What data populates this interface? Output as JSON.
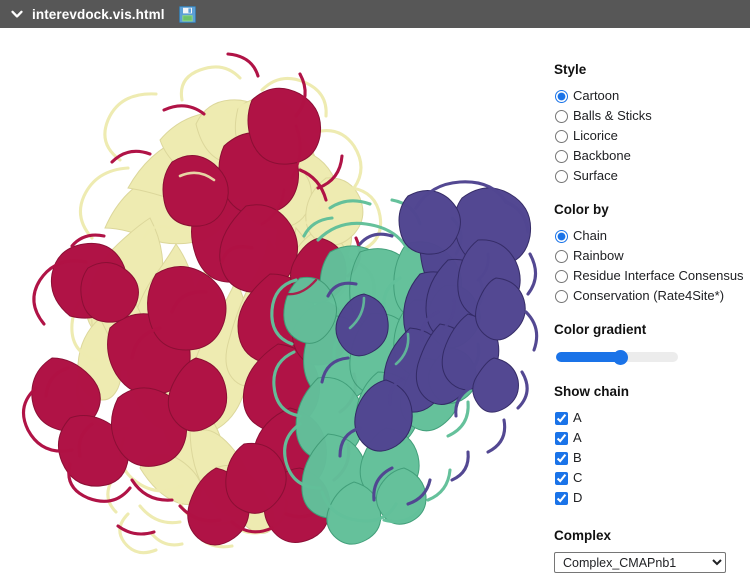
{
  "titlebar": {
    "collapse_icon": "chevron-down-icon",
    "title": "interevdock.vis.html",
    "save_icon": "floppy-disk-save-icon",
    "background": "#575757",
    "text_color": "#ffffff"
  },
  "panel": {
    "style": {
      "heading": "Style",
      "selected": "Cartoon",
      "options": [
        {
          "label": "Cartoon",
          "checked": true
        },
        {
          "label": "Balls & Sticks",
          "checked": false
        },
        {
          "label": "Licorice",
          "checked": false
        },
        {
          "label": "Backbone",
          "checked": false
        },
        {
          "label": "Surface",
          "checked": false
        }
      ]
    },
    "color_by": {
      "heading": "Color by",
      "selected": "Chain",
      "options": [
        {
          "label": "Chain",
          "checked": true
        },
        {
          "label": "Rainbow",
          "checked": false
        },
        {
          "label": "Residue Interface Consensus",
          "checked": false
        },
        {
          "label": "Conservation (Rate4Site*)",
          "checked": false
        }
      ]
    },
    "color_gradient": {
      "heading": "Color gradient",
      "value": 53,
      "min": 0,
      "max": 100,
      "accent": "#1a73e8",
      "track": "#ececec"
    },
    "show_chain": {
      "heading": "Show chain",
      "options": [
        {
          "label": "A",
          "checked": true
        },
        {
          "label": "A",
          "checked": true
        },
        {
          "label": "B",
          "checked": true
        },
        {
          "label": "C",
          "checked": true
        },
        {
          "label": "D",
          "checked": true
        }
      ]
    },
    "complex": {
      "heading": "Complex",
      "selected": "Complex_CMAPnb1",
      "options": [
        "Complex_CMAPnb1"
      ]
    }
  },
  "viewer": {
    "representation": "cartoon",
    "background": "#ffffff",
    "chain_colors": {
      "crimson": "#b01144",
      "pale_yellow": "#eeebb0",
      "green": "#62c09a",
      "purple": "#5146918"
    },
    "chain_color_list": [
      "#b01144",
      "#eeebb0",
      "#62c09a",
      "#514691"
    ]
  }
}
